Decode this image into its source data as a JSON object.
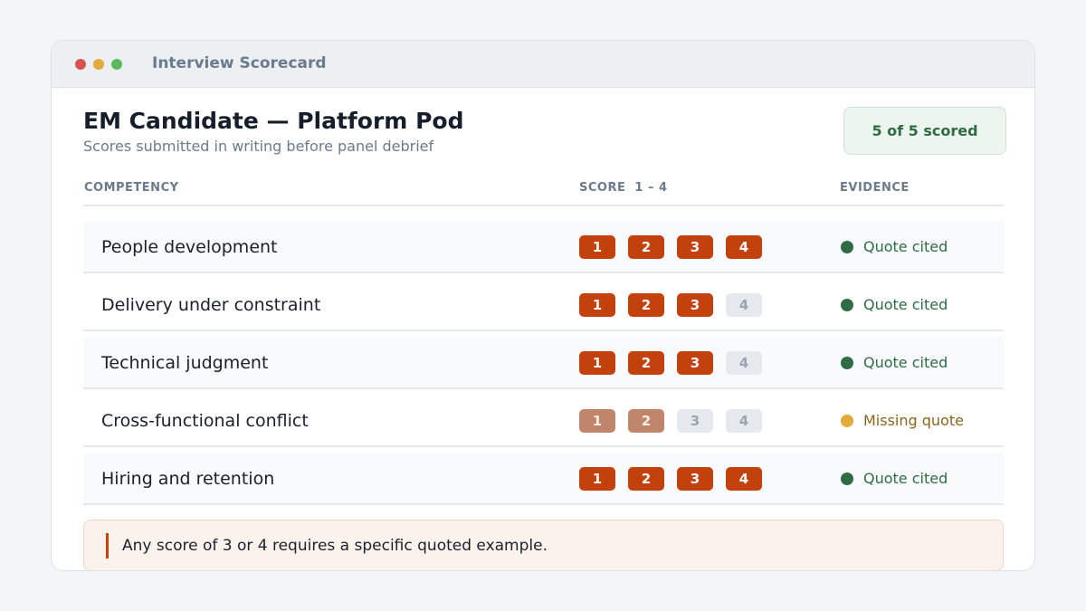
{
  "window": {
    "title": "Interview Scorecard"
  },
  "header": {
    "title": "EM Candidate — Platform Pod",
    "subtitle": "Scores submitted in writing before panel debrief",
    "badge": "5 of 5 scored"
  },
  "table": {
    "columns": {
      "competency": "COMPETENCY",
      "score": "SCORE  1 – 4",
      "evidence": "EVIDENCE"
    },
    "rows": [
      {
        "competency": "People development",
        "score": 4,
        "scale": [
          "1",
          "2",
          "3",
          "4"
        ],
        "evidence": "Quote cited",
        "evidence_status": "cited"
      },
      {
        "competency": "Delivery under constraint",
        "score": 3,
        "scale": [
          "1",
          "2",
          "3",
          "4"
        ],
        "evidence": "Quote cited",
        "evidence_status": "cited"
      },
      {
        "competency": "Technical judgment",
        "score": 3,
        "scale": [
          "1",
          "2",
          "3",
          "4"
        ],
        "evidence": "Quote cited",
        "evidence_status": "cited"
      },
      {
        "competency": "Cross-functional conflict",
        "score": 2,
        "scale": [
          "1",
          "2",
          "3",
          "4"
        ],
        "evidence": "Missing quote",
        "evidence_status": "missing"
      },
      {
        "competency": "Hiring and retention",
        "score": 4,
        "scale": [
          "1",
          "2",
          "3",
          "4"
        ],
        "evidence": "Quote cited",
        "evidence_status": "cited"
      }
    ]
  },
  "note": {
    "text": "Any score of 3 or 4 requires a specific quoted example."
  },
  "colors": {
    "accent": "#c2410c",
    "accent_muted": "#c0866b",
    "success": "#2f6b45",
    "warning": "#e3a93a"
  }
}
